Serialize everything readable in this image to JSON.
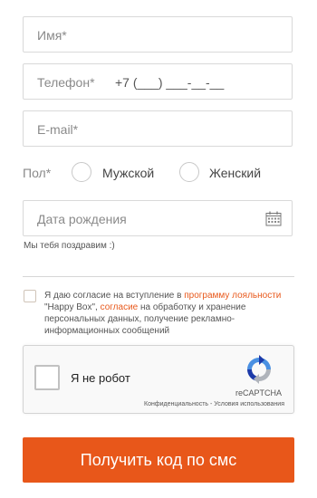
{
  "form": {
    "name_placeholder": "Имя*",
    "phone_placeholder": "Телефон*",
    "phone_mask": "+7 (___) ___-__-__",
    "email_placeholder": "E-mail*",
    "gender_label": "Пол*",
    "gender_options": [
      "Мужской",
      "Женский"
    ],
    "birthdate_placeholder": "Дата рождения",
    "birthdate_hint": "Мы тебя поздравим :)",
    "consent": {
      "text_before_link": "Я даю согласие на вступление в ",
      "loyalty_link": "программу лояльности",
      "text_middle": " \"Happy Box\", ",
      "consent_link": "согласие",
      "text_after": " на обработку и хранение персональных данных, получение рекламно-информационных сообщений"
    },
    "recaptcha": {
      "label": "Я не робот",
      "brand": "reCAPTCHA",
      "privacy": "Конфиденциальность",
      "separator": " - ",
      "terms": "Условия использования"
    },
    "submit_label": "Получить код по смс"
  },
  "colors": {
    "accent": "#e8571a",
    "link": "#e8591c",
    "border": "#d9d9d9",
    "placeholder": "#8a8a8a"
  },
  "icons": {
    "birthdate": "calendar-icon",
    "captcha": "recaptcha-logo-icon"
  }
}
